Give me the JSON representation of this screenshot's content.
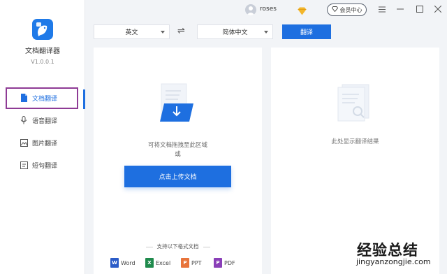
{
  "app": {
    "name": "文档翻译器",
    "version": "V1.0.0.1",
    "brand_color": "#1e6fe0",
    "logo_icon": "bird-chat-icon"
  },
  "sidebar": {
    "items": [
      {
        "label": "文档翻译",
        "icon": "document-icon",
        "active": true
      },
      {
        "label": "语音翻译",
        "icon": "microphone-icon",
        "active": false
      },
      {
        "label": "图片翻译",
        "icon": "image-icon",
        "active": false
      },
      {
        "label": "短句翻译",
        "icon": "text-icon",
        "active": false
      }
    ]
  },
  "titlebar": {
    "username": "roses",
    "member_label": "会员中心",
    "controls": [
      "menu-icon",
      "minimize-icon",
      "maximize-icon",
      "close-icon"
    ]
  },
  "toolbar": {
    "source_lang": "英文",
    "target_lang": "简体中文",
    "translate_label": "翻译"
  },
  "upload": {
    "hint_line1": "可将文档拖拽至此区域",
    "hint_line2": "或",
    "button_label": "点击上传文档",
    "formats_title": "支持以下格式文档",
    "formats": [
      {
        "label": "Word",
        "color": "#2b5cc8",
        "letter": "W"
      },
      {
        "label": "Excel",
        "color": "#1f8a4c",
        "letter": "X"
      },
      {
        "label": "PPT",
        "color": "#e8743b",
        "letter": "P"
      },
      {
        "label": "PDF",
        "color": "#8a3fb8",
        "letter": "P"
      }
    ]
  },
  "result": {
    "hint": "此处显示翻译结果"
  },
  "watermark": {
    "main": "经验总结",
    "sub": "jingyanzongjie.com"
  }
}
